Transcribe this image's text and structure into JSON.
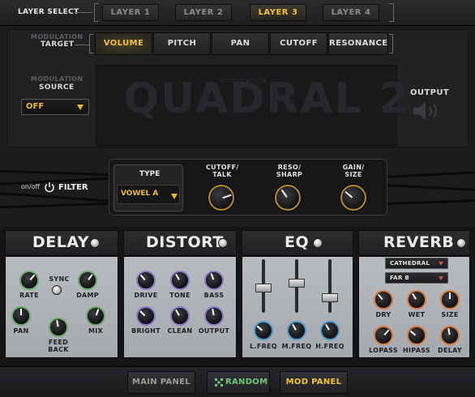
{
  "header": {
    "layer_select_label": "LAYER SELECT",
    "layers": [
      "LAYER 1",
      "LAYER 2",
      "LAYER 3",
      "LAYER 4"
    ],
    "active_layer": "LAYER 3"
  },
  "modulation": {
    "target_small": "MODULATION",
    "target_label": "TARGET",
    "targets": [
      "VOLUME",
      "PITCH",
      "PAN",
      "CUTOFF",
      "RESONANCE"
    ],
    "active_target": "VOLUME",
    "source_small": "MODULATION",
    "source_label": "SOURCE",
    "source_value": "OFF",
    "display_logo": "QUADRAL 2",
    "display_sub": "MODULATION",
    "output_label": "OUTPUT"
  },
  "filter": {
    "onoff_label": "on/off",
    "filter_label": "FILTER",
    "type_label": "TYPE",
    "type_value": "VOWEL A",
    "knobs": [
      {
        "label": "CUTOFF/\nTALK",
        "line1": "CUTOFF/",
        "line2": "TALK"
      },
      {
        "label": "RESO/\nSHARP",
        "line1": "RESO/",
        "line2": "SHARP"
      },
      {
        "label": "GAIN/\nSIZE",
        "line1": "GAIN/",
        "line2": "SIZE"
      }
    ]
  },
  "effects": {
    "delay": {
      "title": "DELAY",
      "sync_label": "SYNC",
      "knobs": [
        "RATE",
        "DAMP",
        "PAN",
        "MIX"
      ],
      "feedback_line1": "FEED",
      "feedback_line2": "BACK"
    },
    "distort": {
      "title": "DISTORT",
      "knobs": [
        "DRIVE",
        "TONE",
        "BASS",
        "BRIGHT",
        "CLEAN",
        "OUTPUT"
      ]
    },
    "eq": {
      "title": "EQ",
      "knobs": [
        "L.FREQ",
        "M.FREQ",
        "H.FREQ"
      ]
    },
    "reverb": {
      "title": "REVERB",
      "preset_1": "CATHEDRAL",
      "preset_2": "FAR B",
      "knobs": [
        "DRY",
        "WET",
        "SIZE",
        "LOPASS",
        "HIPASS",
        "DELAY"
      ]
    }
  },
  "footer": {
    "main_panel": "MAIN PANEL",
    "random": "RANDOM",
    "mod_panel": "MOD PANEL"
  },
  "colors": {
    "accent_gold": "#f0c040",
    "knob_green": "#6aa86a",
    "knob_purple": "#8a78c8",
    "knob_blue": "#4a9ad0",
    "knob_orange": "#d87a3a",
    "random_green": "#6ec87a"
  }
}
